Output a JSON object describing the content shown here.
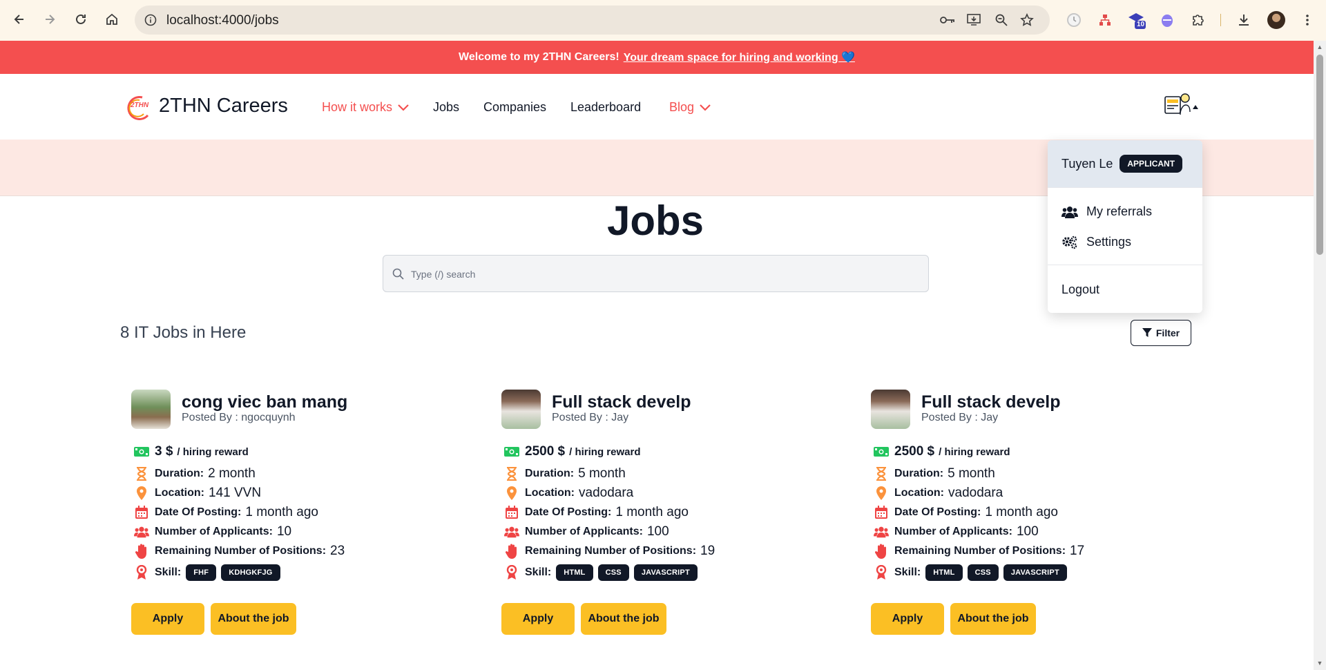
{
  "browser": {
    "url": "localhost:4000/jobs",
    "extension_badge": "10"
  },
  "banner": {
    "text": "Welcome to my 2THN Careers!",
    "link": "Your dream space for hiring and working 💙"
  },
  "header": {
    "brand": "2THN Careers",
    "logo_text": "2THN",
    "nav": [
      {
        "label": "How it works",
        "has_dropdown": true,
        "color": "#f44f4f"
      },
      {
        "label": "Jobs",
        "has_dropdown": false
      },
      {
        "label": "Companies",
        "has_dropdown": false
      },
      {
        "label": "Leaderboard",
        "has_dropdown": false
      },
      {
        "label": "Blog",
        "has_dropdown": true,
        "color": "#f44f4f"
      }
    ],
    "user_menu_icon": "job-seeker-icon"
  },
  "user_dropdown": {
    "name": "Tuyen Le",
    "role": "APPLICANT",
    "items": [
      {
        "label": "My referrals",
        "icon": "users-icon"
      },
      {
        "label": "Settings",
        "icon": "gears-icon"
      }
    ],
    "logout": "Logout"
  },
  "main": {
    "title": "Jobs",
    "search_placeholder": "Type (/) search",
    "jobs_count": "8 IT Jobs in Here",
    "filter_label": "Filter"
  },
  "labels": {
    "reward_unit": "/ hiring reward",
    "duration": "Duration:",
    "location": "Location:",
    "date": "Date Of Posting:",
    "applicants": "Number of Applicants:",
    "remaining": "Remaining Number of Positions:",
    "skill": "Skill:",
    "apply": "Apply",
    "about": "About the job"
  },
  "jobs": [
    {
      "title": "cong viec ban mang",
      "posted_by": "Posted By : ngocquynh",
      "reward": "3 $",
      "duration": "2 month",
      "location": "141 VVN",
      "date": "1 month ago",
      "applicants": "10",
      "remaining": "23",
      "skills": [
        "FHF",
        "KDHGKFJG"
      ]
    },
    {
      "title": "Full stack develp",
      "posted_by": "Posted By : Jay",
      "reward": "2500 $",
      "duration": "5 month",
      "location": "vadodara",
      "date": "1 month ago",
      "applicants": "100",
      "remaining": "19",
      "skills": [
        "HTML",
        "CSS",
        "JAVASCRIPT"
      ]
    },
    {
      "title": "Full stack develp",
      "posted_by": "Posted By : Jay",
      "reward": "2500 $",
      "duration": "5 month",
      "location": "vadodara",
      "date": "1 month ago",
      "applicants": "100",
      "remaining": "17",
      "skills": [
        "HTML",
        "CSS",
        "JAVASCRIPT"
      ]
    }
  ],
  "colors": {
    "brand_red": "#f44f4f",
    "button_yellow": "#fbbf24",
    "tag_dark": "#111827",
    "money_green": "#22c55e",
    "icon_orange": "#fb923c",
    "icon_red": "#ef4444"
  }
}
